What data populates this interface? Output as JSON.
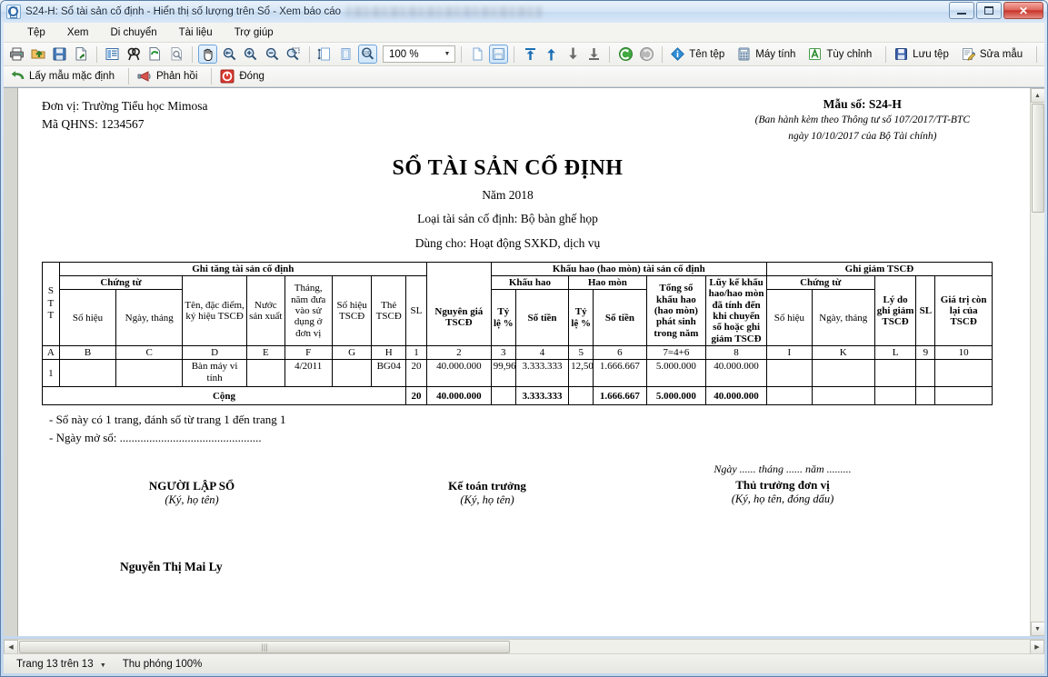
{
  "window": {
    "title": "S24-H: Sổ tài sản cố định - Hiển thị số lượng trên Sổ - Xem báo cáo",
    "minimize_label": "Minimize",
    "maximize_label": "Maximize",
    "close_label": "✕"
  },
  "menu": {
    "items": [
      {
        "label": "Tệp",
        "name": "menu-tep"
      },
      {
        "label": "Xem",
        "name": "menu-xem"
      },
      {
        "label": "Di chuyển",
        "name": "menu-di-chuyen"
      },
      {
        "label": "Tài liệu",
        "name": "menu-tai-lieu"
      },
      {
        "label": "Trợ giúp",
        "name": "menu-tro-giup"
      }
    ]
  },
  "toolbar": {
    "zoom_value": "100 %",
    "buttons": [
      {
        "name": "print-icon",
        "tip": "In"
      },
      {
        "name": "open-folder-icon",
        "tip": "Mở"
      },
      {
        "name": "save-icon",
        "tip": "Lưu"
      },
      {
        "name": "export-icon",
        "tip": "Xuất khẩu"
      },
      {
        "name": "toc-icon",
        "tip": "Mục lục"
      },
      {
        "name": "find-icon",
        "tip": "Tìm kiếm"
      },
      {
        "name": "refresh-icon",
        "tip": "Nạp lại"
      },
      {
        "name": "page-setup-icon",
        "tip": "Thiết lập trang"
      },
      {
        "name": "hand-pan-icon",
        "tip": "Di chuyển"
      },
      {
        "name": "zoom-select-icon",
        "tip": "Thu phóng"
      },
      {
        "name": "zoom-in-icon",
        "tip": "Phóng to"
      },
      {
        "name": "zoom-out-icon",
        "tip": "Thu nhỏ"
      },
      {
        "name": "zoom-area-icon",
        "tip": "Thu phóng vùng"
      },
      {
        "name": "fit-height-icon",
        "tip": "Vừa chiều cao"
      },
      {
        "name": "fit-page-icon",
        "tip": "Vừa trang"
      },
      {
        "name": "zoom-100-icon",
        "tip": "100%"
      },
      {
        "name": "single-page-icon",
        "tip": "Một trang"
      },
      {
        "name": "continuous-page-icon",
        "tip": "Nhiều trang"
      },
      {
        "name": "first-page-icon",
        "tip": "Trang đầu"
      },
      {
        "name": "prev-page-icon",
        "tip": "Trang trước"
      },
      {
        "name": "next-page-icon",
        "tip": "Trang sau"
      },
      {
        "name": "last-page-icon",
        "tip": "Trang cuối"
      },
      {
        "name": "back-icon",
        "tip": "Quay lại"
      },
      {
        "name": "forward-icon",
        "tip": "Tiến tới"
      }
    ],
    "text_buttons": [
      {
        "label": "Tên tệp",
        "name": "ten-tep-button",
        "icon": "info-icon"
      },
      {
        "label": "Máy tính",
        "name": "may-tinh-button",
        "icon": "calculator-icon"
      },
      {
        "label": "Tùy chỉnh",
        "name": "tuy-chinh-button",
        "icon": "customize-icon"
      },
      {
        "label": "Lưu tệp",
        "name": "luu-tep-button",
        "icon": "floppy-icon"
      },
      {
        "label": "Sửa mẫu",
        "name": "sua-mau-button",
        "icon": "edit-template-icon"
      }
    ]
  },
  "toolbar2": {
    "items": [
      {
        "label": "Lấy mẫu mặc định",
        "name": "lay-mau-mac-dinh-button",
        "icon": "undo-arrow-icon"
      },
      {
        "label": "Phản hồi",
        "name": "phan-hoi-button",
        "icon": "megaphone-icon"
      },
      {
        "label": "Đóng",
        "name": "dong-button",
        "icon": "close-circle-icon"
      }
    ]
  },
  "statusbar": {
    "page_label": "Trang 13 trên 13",
    "zoom_label": "Thu phóng 100%"
  },
  "report": {
    "unit_line1": "Đơn vị: Trường Tiểu học Mimosa",
    "unit_line2": "Mã QHNS: 1234567",
    "form_no": "Mẫu số: S24-H",
    "form_sub1": "(Ban hành kèm theo Thông tư số 107/2017/TT-BTC",
    "form_sub2": "ngày 10/10/2017 của Bộ Tài chính)",
    "title": "SỔ TÀI SẢN CỐ ĐỊNH",
    "year": "Năm 2018",
    "asset_type": "Loại tài sản cố định: Bộ bàn ghế họp",
    "used_for": "Dùng cho: Hoạt động SXKD, dịch vụ",
    "note1": "- Sổ này có 1 trang, đánh số từ trang 1 đến trang 1",
    "note2": "- Ngày mở sổ: ................................................",
    "date_line": "Ngày ...... tháng ...... năm .........",
    "sign1_title": "NGƯỜI LẬP SỔ",
    "sign1_sub": "(Ký, họ tên)",
    "sign2_title": "Kế toán trưởng",
    "sign2_sub": "(Ký, họ tên)",
    "sign3_title": "Thủ trưởng đơn vị",
    "sign3_sub": "(Ký, họ tên, đóng dấu)",
    "signer_name": "Nguyễn Thị Mai Ly"
  },
  "table": {
    "group_increase": "Ghi tăng tài sản cố định",
    "group_depreciation": "Khấu hao (hao mòn) tài sản cố định",
    "group_decrease": "Ghi giảm TSCĐ",
    "sub_chungtu_1": "Chứng từ",
    "sub_chungtu_2": "Chứng từ",
    "sub_khauhao": "Khấu hao",
    "sub_haomon": "Hao mòn",
    "h_stt": "S\nT\nT",
    "h_sohieu1": "Số hiệu",
    "h_ngaythang1": "Ngày, tháng",
    "h_ten": "Tên, đặc điểm, ký hiệu TSCĐ",
    "h_nuoc": "Nước sản xuất",
    "h_thangnam": "Tháng, năm đưa vào sử dụng ở đơn vị",
    "h_sohieutscd": "Số hiệu TSCĐ",
    "h_the": "Thẻ TSCĐ",
    "h_sl1": "SL",
    "h_nguyengia": "Nguyên giá TSCĐ",
    "h_tyle1": "Tỷ lệ %",
    "h_sotien1": "Số tiền",
    "h_tyle2": "Tỷ lệ %",
    "h_sotien2": "Số tiền",
    "h_tongso": "Tổng số khấu hao (hao mòn) phát sinh trong năm",
    "h_luyke": "Lũy kế khấu hao/hao mòn đã tính đến khi chuyển sổ hoặc ghi giảm TSCĐ",
    "h_sohieu2": "Số hiệu",
    "h_ngaythang2": "Ngày, tháng",
    "h_lydo": "Lý do ghi giảm TSCĐ",
    "h_sl2": "SL",
    "h_giatri": "Giá trị còn lại của TSCĐ",
    "codes": [
      "A",
      "B",
      "C",
      "D",
      "E",
      "F",
      "G",
      "H",
      "1",
      "2",
      "3",
      "4",
      "5",
      "6",
      "7=4+6",
      "8",
      "I",
      "K",
      "L",
      "9",
      "10"
    ],
    "rows": [
      {
        "stt": "1",
        "sohieu1": "",
        "ngaythang1": "",
        "ten": "Bàn máy vi tính",
        "nuoc": "",
        "thangnam": "4/2011",
        "sohieutscd": "",
        "the": "BG04",
        "sl1": "20",
        "nguyengia": "40.000.000",
        "tyle1": "99,96",
        "sotien1": "3.333.333",
        "tyle2": "12,50",
        "sotien2": "1.666.667",
        "tongso": "5.000.000",
        "luyke": "40.000.000",
        "sohieu2": "",
        "ngaythang2": "",
        "lydo": "",
        "sl2": "",
        "giatri": ""
      }
    ],
    "total": {
      "label": "Cộng",
      "sl1": "20",
      "nguyengia": "40.000.000",
      "tyle1": "",
      "sotien1": "3.333.333",
      "tyle2": "",
      "sotien2": "1.666.667",
      "tongso": "5.000.000",
      "luyke": "40.000.000",
      "sohieu2": "",
      "ngaythang2": "",
      "lydo": "",
      "sl2": "",
      "giatri": ""
    }
  },
  "colors": {
    "accent": "#2f6aa8",
    "close_red": "#c8352b",
    "toolbar_bg": "#f3f3f0"
  }
}
